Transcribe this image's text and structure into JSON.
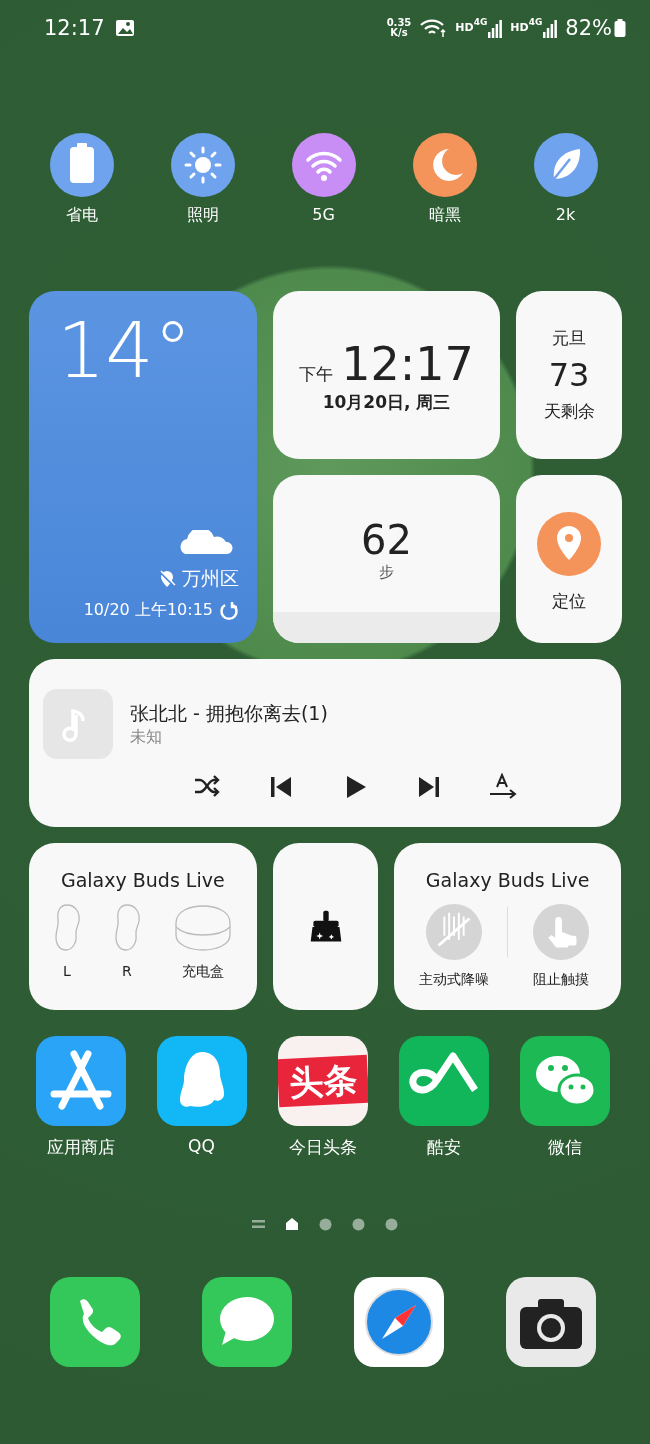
{
  "status_bar": {
    "time": "12:17",
    "speed_value": "0.35",
    "speed_unit": "K/s",
    "sims": [
      {
        "hd": "HD",
        "network": "4G"
      },
      {
        "hd": "HD",
        "network": "4G"
      }
    ],
    "battery": "82%"
  },
  "quick_toggles": [
    {
      "kind": "battery",
      "label": "省电",
      "color": "#6fa3ee"
    },
    {
      "kind": "sun",
      "label": "照明",
      "color": "#6fa3ee"
    },
    {
      "kind": "wifi",
      "label": "5G",
      "color": "#c98ef5"
    },
    {
      "kind": "moon",
      "label": "暗黑",
      "color": "#f4935a"
    },
    {
      "kind": "leaf",
      "label": "2k",
      "color": "#6fa3ee"
    }
  ],
  "weather": {
    "temperature": "14°",
    "location": "万州区",
    "updated": "10/20 上午10:15"
  },
  "clock": {
    "period": "下午",
    "time": "12:17",
    "date": "10月20日, 周三"
  },
  "countdown": {
    "event": "元旦",
    "days": "73",
    "caption": "天剩余"
  },
  "steps": {
    "count": "62",
    "unit": "步"
  },
  "location": {
    "label": "定位"
  },
  "music": {
    "title": "张北北 - 拥抱你离去(1)",
    "artist": "未知",
    "controls": [
      {
        "kind": "shuffle"
      },
      {
        "kind": "previous"
      },
      {
        "kind": "play"
      },
      {
        "kind": "next"
      },
      {
        "kind": "text-arrow"
      }
    ]
  },
  "buds_battery": {
    "title": "Galaxy Buds Live",
    "items": [
      {
        "kind": "bud",
        "label": "L"
      },
      {
        "kind": "bud",
        "label": "R"
      },
      {
        "kind": "case",
        "label": "充电盒"
      }
    ]
  },
  "buds_controls": {
    "title": "Galaxy Buds Live",
    "items": [
      {
        "kind": "noise",
        "label": "主动式降噪",
        "on": false
      },
      {
        "kind": "touch",
        "label": "阻止触摸",
        "on": false
      }
    ]
  },
  "apps": [
    {
      "kind": "store",
      "label": "应用商店"
    },
    {
      "kind": "penguin",
      "label": "QQ"
    },
    {
      "kind": "news",
      "label": "今日头条",
      "logo_text": "头条"
    },
    {
      "kind": "coolapk",
      "label": "酷安"
    },
    {
      "kind": "chat",
      "label": "微信"
    }
  ],
  "page_indicator": [
    {
      "kind": "list",
      "selected": false
    },
    {
      "kind": "home",
      "selected": true
    },
    {
      "kind": "dot",
      "selected": false
    },
    {
      "kind": "dot",
      "selected": false
    },
    {
      "kind": "dot",
      "selected": false
    }
  ],
  "dock": [
    {
      "kind": "phone"
    },
    {
      "kind": "messages"
    },
    {
      "kind": "compass"
    },
    {
      "kind": "camera"
    }
  ]
}
